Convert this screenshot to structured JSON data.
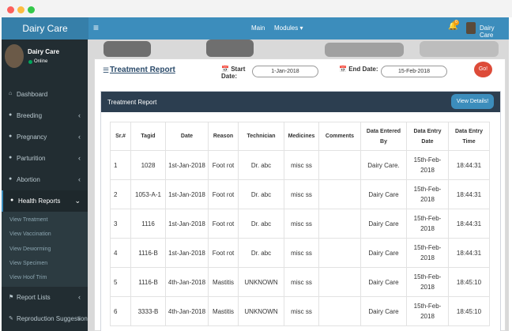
{
  "app": {
    "brand": "Dairy Care",
    "hamburger": "≡"
  },
  "topnav": {
    "main": "Main",
    "modules": "Modules ▾",
    "bell": "🔔",
    "badge": "0",
    "user": "Dairy Care"
  },
  "sidebar": {
    "user": {
      "name": "Dairy Care",
      "status": "Online"
    },
    "items": [
      {
        "icon": "⌂",
        "label": "Dashboard",
        "chev": ""
      },
      {
        "icon": "●",
        "label": "Breeding",
        "chev": "‹"
      },
      {
        "icon": "●",
        "label": "Pregnancy",
        "chev": "‹"
      },
      {
        "icon": "●",
        "label": "Parturition",
        "chev": "‹"
      },
      {
        "icon": "●",
        "label": "Abortion",
        "chev": "‹"
      },
      {
        "icon": "●",
        "label": "Health Reports",
        "chev": "⌄"
      },
      {
        "icon": "⚑",
        "label": "Report Lists",
        "chev": "‹"
      },
      {
        "icon": "✎",
        "label": "Reproduction Suggestion",
        "chev": "‹"
      }
    ],
    "submenu": [
      "View Treatment",
      "View Vaccination",
      "View Deworming",
      "View Specimen",
      "View Hoof Trim"
    ]
  },
  "report": {
    "title": "Treatment Report",
    "start_label": "Start\nDate:",
    "start_value": "1-Jan-2018",
    "end_label": "End Date:",
    "end_value": "15-Feb-2018",
    "go": "Go!",
    "box_title": "Treatment Report",
    "details": "View Details!"
  },
  "table": {
    "headers": [
      "Sr.#",
      "Tagid",
      "Date",
      "Reason",
      "Technician",
      "Medicines",
      "Comments",
      "Data Entered By",
      "Data Entry Date",
      "Data Entry Time"
    ],
    "rows": [
      [
        "1",
        "1028",
        "1st-Jan-2018",
        "Foot rot",
        "Dr. abc",
        "misc ss",
        "",
        "Dairy Care.",
        "15th-Feb-2018",
        "18:44:31"
      ],
      [
        "2",
        "1053-A-1",
        "1st-Jan-2018",
        "Foot rot",
        "Dr. abc",
        "misc ss",
        "",
        "Dairy Care",
        "15th-Feb-2018",
        "18:44:31"
      ],
      [
        "3",
        "1116",
        "1st-Jan-2018",
        "Foot rot",
        "Dr. abc",
        "misc ss",
        "",
        "Dairy Care",
        "15th-Feb-2018",
        "18:44:31"
      ],
      [
        "4",
        "1116-B",
        "1st-Jan-2018",
        "Foot rot",
        "Dr. abc",
        "misc ss",
        "",
        "Dairy Care",
        "15th-Feb-2018",
        "18:44:31"
      ],
      [
        "5",
        "1116-B",
        "4th-Jan-2018",
        "Mastitis",
        "UNKNOWN",
        "misc ss",
        "",
        "Dairy Care",
        "15th-Feb-2018",
        "18:45:10"
      ],
      [
        "6",
        "3333-B",
        "4th-Jan-2018",
        "Mastitis",
        "UNKNOWN",
        "misc ss",
        "",
        "Dairy Care",
        "15th-Feb-2018",
        "18:45:10"
      ]
    ]
  },
  "colors": {
    "header": "#3c8dbc",
    "sidebar": "#222d32",
    "box_header": "#2c3e50",
    "go": "#dd4b39"
  }
}
